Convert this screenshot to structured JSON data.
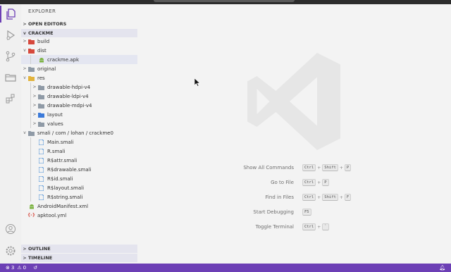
{
  "colors": {
    "accent": "#6c3fb5",
    "status_bar": "#6c3fb5"
  },
  "activity_bar": [
    {
      "icon": "files-icon",
      "active": true
    },
    {
      "icon": "run-debug-icon",
      "active": false
    },
    {
      "icon": "source-control-icon",
      "active": false
    },
    {
      "icon": "folder-icon",
      "active": false
    },
    {
      "icon": "extensions-icon",
      "active": false
    }
  ],
  "activity_bottom": [
    {
      "icon": "account-icon"
    },
    {
      "icon": "settings-gear-icon"
    }
  ],
  "sidebar": {
    "title": "EXPLORER",
    "open_editors": "OPEN EDITORS",
    "project": "CRACKME",
    "outline": "OUTLINE",
    "timeline": "TIMELINE"
  },
  "tree": [
    {
      "label": "build",
      "icon": "folder-red-icon",
      "twisty": ">"
    },
    {
      "label": "dist",
      "icon": "folder-red-open-icon",
      "twisty": "v"
    },
    {
      "label": "crackme.apk",
      "icon": "android-icon",
      "twisty": ""
    },
    {
      "label": "original",
      "icon": "folder-icon",
      "twisty": ">"
    },
    {
      "label": "res",
      "icon": "folder-yellow-open-icon",
      "twisty": "v"
    },
    {
      "label": "drawable-hdpi-v4",
      "icon": "folder-icon",
      "twisty": ">"
    },
    {
      "label": "drawable-ldpi-v4",
      "icon": "folder-icon",
      "twisty": ">"
    },
    {
      "label": "drawable-mdpi-v4",
      "icon": "folder-icon",
      "twisty": ">"
    },
    {
      "label": "layout",
      "icon": "folder-blue-icon",
      "twisty": ">"
    },
    {
      "label": "values",
      "icon": "folder-icon",
      "twisty": ">"
    },
    {
      "label": "smali / com / lohan / crackme0",
      "icon": "folder-open-icon",
      "twisty": "v"
    },
    {
      "label": "Main.smali",
      "icon": "file-icon",
      "twisty": ""
    },
    {
      "label": "R.smali",
      "icon": "file-icon",
      "twisty": ""
    },
    {
      "label": "R$attr.smali",
      "icon": "file-icon",
      "twisty": ""
    },
    {
      "label": "R$drawable.smali",
      "icon": "file-icon",
      "twisty": ""
    },
    {
      "label": "R$id.smali",
      "icon": "file-icon",
      "twisty": ""
    },
    {
      "label": "R$layout.smali",
      "icon": "file-icon",
      "twisty": ""
    },
    {
      "label": "R$string.smali",
      "icon": "file-icon",
      "twisty": ""
    },
    {
      "label": "AndroidManifest.xml",
      "icon": "android-icon",
      "twisty": ""
    },
    {
      "label": "apktool.yml",
      "icon": "yaml-icon",
      "twisty": ""
    }
  ],
  "commands": [
    {
      "label": "Show All Commands",
      "keys": [
        "Ctrl",
        "Shift",
        "P"
      ]
    },
    {
      "label": "Go to File",
      "keys": [
        "Ctrl",
        "P"
      ]
    },
    {
      "label": "Find in Files",
      "keys": [
        "Ctrl",
        "Shift",
        "F"
      ]
    },
    {
      "label": "Start Debugging",
      "keys": [
        "F5"
      ]
    },
    {
      "label": "Toggle Terminal",
      "keys": [
        "Ctrl",
        "`"
      ]
    }
  ],
  "status": {
    "errors": "3",
    "warnings": "0"
  }
}
